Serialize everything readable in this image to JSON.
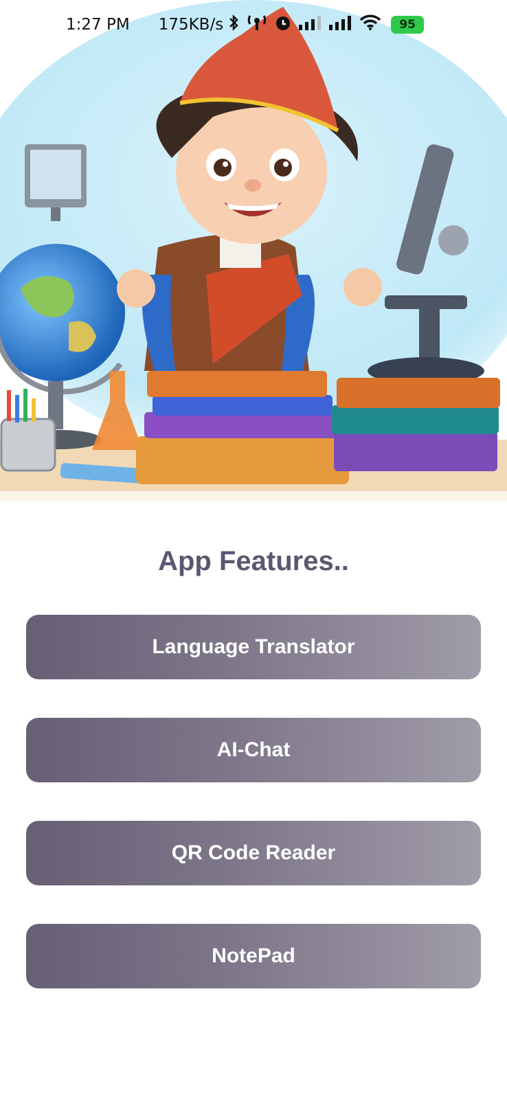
{
  "status_bar": {
    "time": "1:27 PM",
    "network_speed": "175KB/s",
    "battery": "95",
    "icons": [
      "bluetooth-icon",
      "hotspot-icon",
      "alarm-icon",
      "signal-icon",
      "signal-icon",
      "wifi-icon",
      "battery-icon"
    ]
  },
  "hero": {
    "illustration": "student-with-books-globe-microscope"
  },
  "main": {
    "title": "App Features..",
    "features": [
      {
        "label": "Language Translator"
      },
      {
        "label": "AI-Chat"
      },
      {
        "label": "QR Code Reader"
      },
      {
        "label": "NotePad"
      }
    ]
  },
  "colors": {
    "title": "#5d5670",
    "button_gradient_start": "#675f75",
    "button_gradient_end": "#a19ca9",
    "button_text": "#ffffff",
    "battery": "#2fc94a"
  }
}
